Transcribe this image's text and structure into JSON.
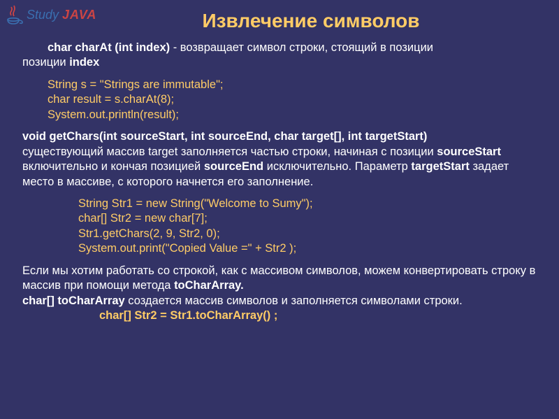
{
  "logo": {
    "study": "Study",
    "java": "JAVA"
  },
  "title": "Извлечение символов",
  "p1": {
    "sig": "char charAt (int index)",
    "desc_a": " - возвращает символ строки, стоящий в позиции ",
    "desc_b": "index"
  },
  "code1": {
    "l1": "String s = \"Strings are immutable\";",
    "l2": "char result = s.charAt(8);",
    "l3": "System.out.println(result);"
  },
  "p2": {
    "sig": "void getChars(int sourceStart, int sourceEnd, char target[], int targetStart)",
    "t1": "существующий массив target заполняется частью строки, начиная     с позиции ",
    "t2": "sourceStart",
    "t3": " включительно и кончая позицией ",
    "t4": "sourceEnd",
    "t5": " исключительно. Параметр     ",
    "t6": "targetStart",
    "t7": " задает место в массиве, с которого начнется его заполнение."
  },
  "code2": {
    "l1": "String Str1 = new String(\"Welcome to Sumy\");",
    "l2": "char[] Str2 = new char[7];",
    "l3": "Str1.getChars(2, 9, Str2, 0);",
    "l4": "System.out.print(\"Copied Value =\"  + Str2 );"
  },
  "p3": {
    "t1": "Если мы хотим работать со строкой, как с массивом символов, можем конвертировать строку в массив при помощи метода ",
    "t2": "toCharArray.",
    "t3": "char[] toCharArray",
    "t4": " создается массив символов и заполняется символами строки."
  },
  "code3": {
    "l1": "char[] Str2 = Str1.toCharArray() ;"
  }
}
